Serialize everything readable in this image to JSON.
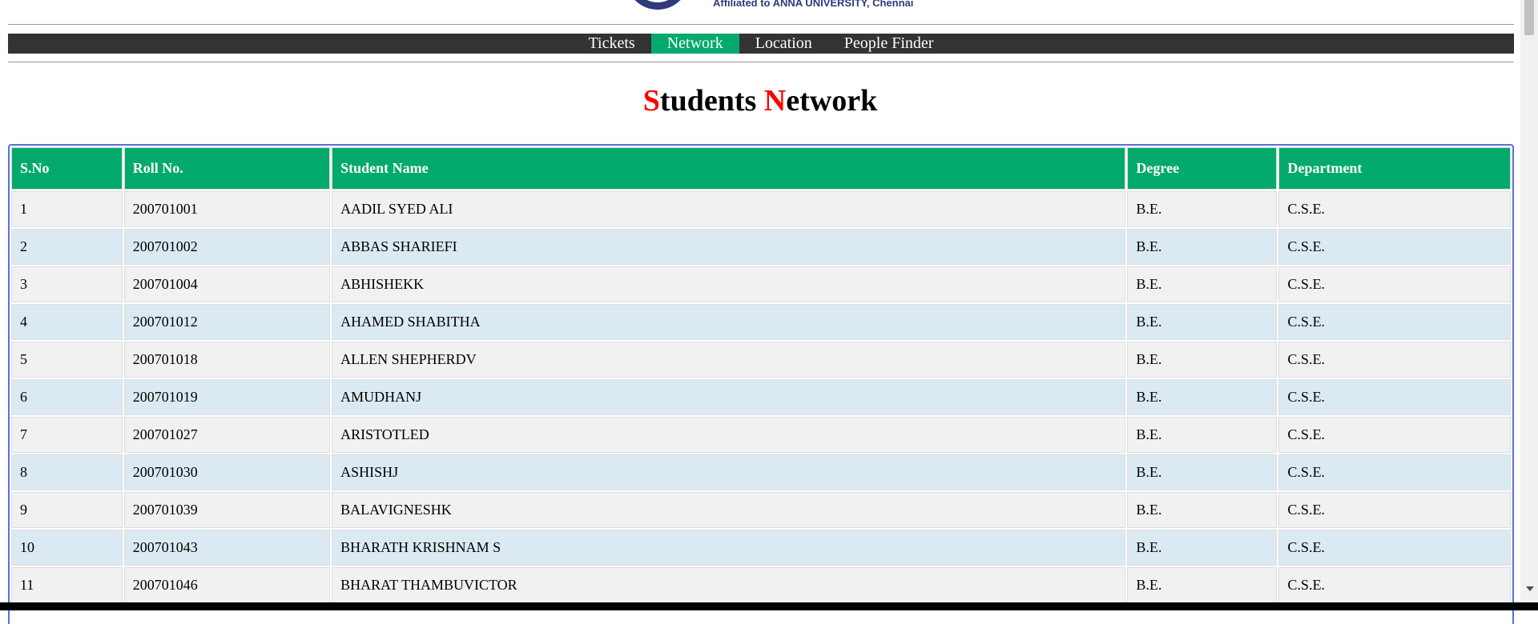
{
  "header": {
    "affiliation": "Affiliated to ANNA UNIVERSITY, Chennai"
  },
  "nav": {
    "items": [
      {
        "label": "Tickets",
        "active": false
      },
      {
        "label": "Network",
        "active": true
      },
      {
        "label": "Location",
        "active": false
      },
      {
        "label": "People Finder",
        "active": false
      }
    ]
  },
  "page": {
    "title_first_initial": "S",
    "title_first_rest": "tudents",
    "title_second_initial": "N",
    "title_second_rest": "etwork"
  },
  "table": {
    "headers": [
      "S.No",
      "Roll No.",
      "Student Name",
      "Degree",
      "Department"
    ],
    "rows": [
      [
        "1",
        "200701001",
        "AADIL SYED ALI",
        "B.E.",
        "C.S.E."
      ],
      [
        "2",
        "200701002",
        "ABBAS SHARIEFI",
        "B.E.",
        "C.S.E."
      ],
      [
        "3",
        "200701004",
        "ABHISHEKK",
        "B.E.",
        "C.S.E."
      ],
      [
        "4",
        "200701012",
        "AHAMED SHABITHA",
        "B.E.",
        "C.S.E."
      ],
      [
        "5",
        "200701018",
        "ALLEN SHEPHERDV",
        "B.E.",
        "C.S.E."
      ],
      [
        "6",
        "200701019",
        "AMUDHANJ",
        "B.E.",
        "C.S.E."
      ],
      [
        "7",
        "200701027",
        "ARISTOTLED",
        "B.E.",
        "C.S.E."
      ],
      [
        "8",
        "200701030",
        "ASHISHJ",
        "B.E.",
        "C.S.E."
      ],
      [
        "9",
        "200701039",
        "BALAVIGNESHK",
        "B.E.",
        "C.S.E."
      ],
      [
        "10",
        "200701043",
        "BHARATH KRISHNAM S",
        "B.E.",
        "C.S.E."
      ],
      [
        "11",
        "200701046",
        "BHARAT THAMBUVICTOR",
        "B.E.",
        "C.S.E."
      ]
    ]
  },
  "colors": {
    "accent": "#04aa6d",
    "nav_bg": "#333333",
    "title_initial": "#ff0000",
    "row_odd": "#f1f1f1",
    "row_even": "#dbeaf2",
    "table_border": "#5b6fe0"
  }
}
